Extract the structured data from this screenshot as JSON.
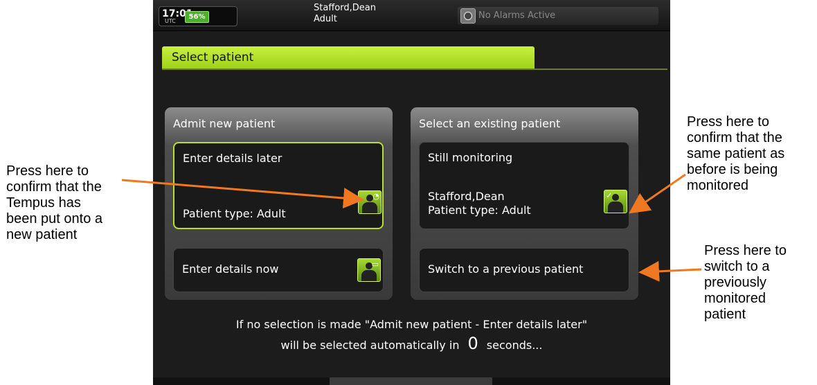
{
  "status_bar": {
    "time": "17:01",
    "time_zone": "UTC",
    "battery": "56%",
    "patient_name": "Stafford,Dean",
    "patient_type": "Adult",
    "alarm_status": "No Alarms Active"
  },
  "screen_title": "Select patient",
  "admit_panel": {
    "title": "Admit new patient",
    "enter_later": {
      "label": "Enter details later",
      "patient_type": "Patient type: Adult"
    },
    "enter_now": {
      "label": "Enter details now"
    }
  },
  "existing_panel": {
    "title": "Select an existing patient",
    "still_monitoring": {
      "label": "Still monitoring",
      "name": "Stafford,Dean",
      "patient_type": "Patient type: Adult"
    },
    "switch_previous": {
      "label": "Switch to a previous patient"
    }
  },
  "footer": {
    "line1": "If no selection is made \"Admit new patient - Enter details later\"",
    "line2_before": "will be selected automatically in",
    "countdown": "0",
    "line2_after": "seconds..."
  },
  "annotations": {
    "left": "Press here to\nconfirm that the\nTempus has\nbeen put onto a\nnew patient",
    "right_top": "Press here to\nconfirm that the\nsame patient as\nbefore is being\nmonitored",
    "right_bottom": "Press here to\nswitch to a\npreviously\nmonitored\npatient"
  },
  "colors": {
    "accent_green": "#b8e02c",
    "annotation_arrow": "#f07820"
  }
}
